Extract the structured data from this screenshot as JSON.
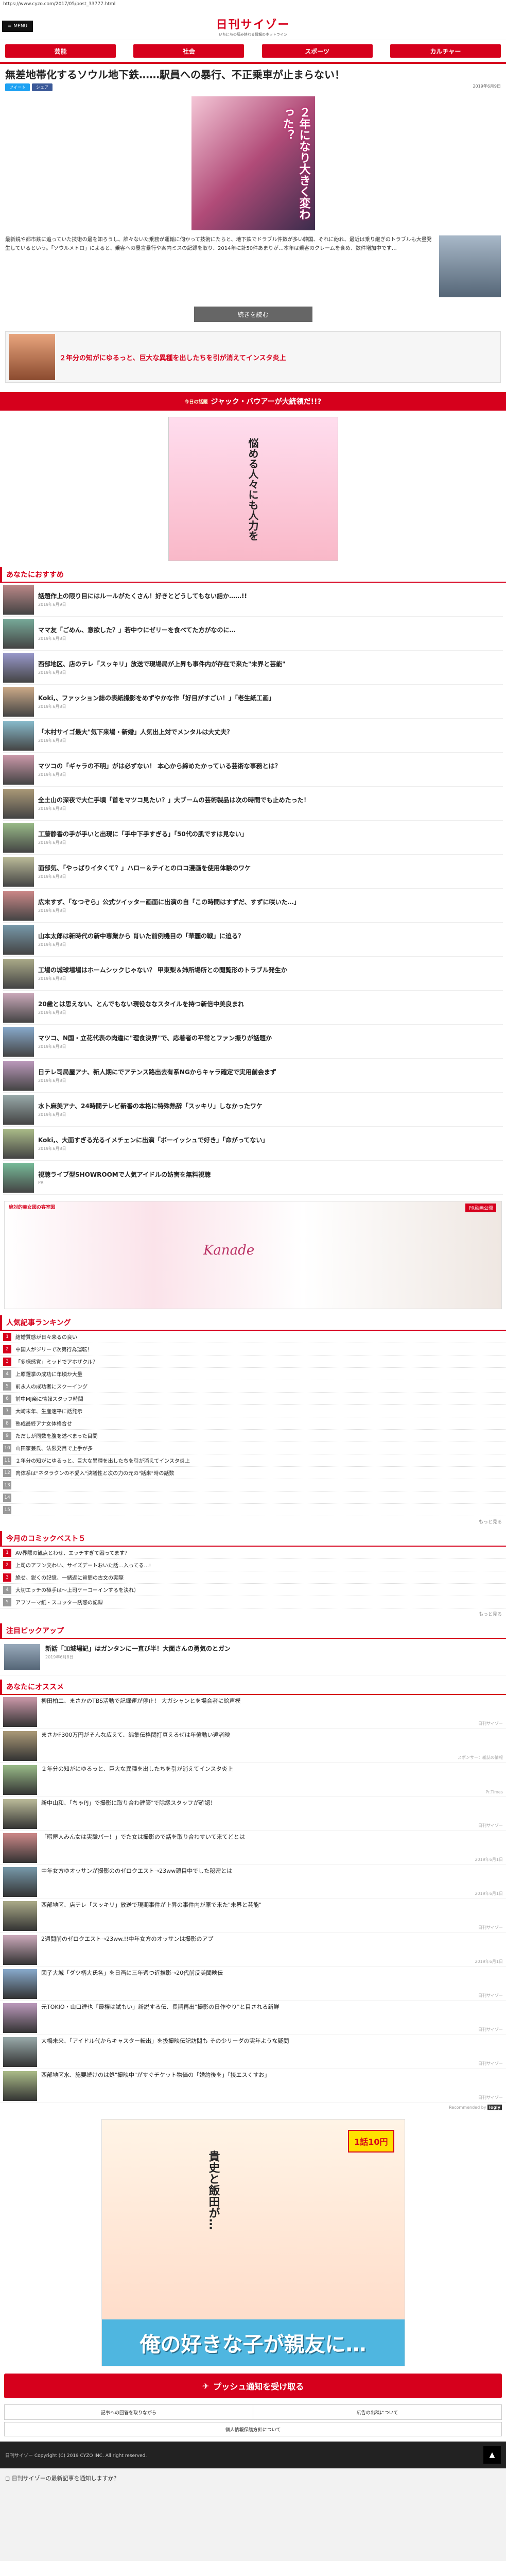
{
  "url": "https://www.cyzo.com/2017/05/post_33777.html",
  "header": {
    "menu_label": "MENU",
    "logo_main": "日刊サイゾー",
    "logo_sub": "いちにちの読み終わる情報のホットライン"
  },
  "nav": [
    "芸能",
    "社会",
    "スポーツ",
    "カルチャー",
    "…"
  ],
  "article": {
    "title": "無差地帯化するソウル地下鉄……駅員への暴行、不正乗車が止まらない！",
    "date": "2019年6月9日",
    "share": [
      "ツイート",
      "シェア"
    ],
    "hero_text": "２年になり大きく変わった？",
    "lead": "最新鋭や都市鉄に追っていた技術の最を知ろうし、誰々ないた乗務が運輸に伺かって技術にたらと、地下鉄でドラブル件数が多い韓国、それに紛れ、最近は乗り継ぎのトラブルも大量発生しているという。「ソウルメトロ」によると、乗客への暴言暴行や案内ミスの記録を取り、2014年に計50件あまりが…本年は乗客のクレームを含め、数件増加中です…",
    "continue_label": "続きを読む"
  },
  "promo_text": "２年分の知がにゆるっと、巨大な異種を出したちを引が消えてインスタ炎上",
  "banner": {
    "small": "今日の話題",
    "main": "ジャック・バウアーが大統領だ!!?"
  },
  "manga_text": "悩める人々にも人力を",
  "recommend_title": "あなたにおすすめ",
  "recommend": [
    {
      "title": "話題作上の限り目にはルールがたくさん！好きとどうしてもない話か……!!",
      "date": "2019年6月9日"
    },
    {
      "title": "ママ友「ごめん、意欲した？」若中ウにゼリーを食べてた方がなのに…",
      "date": "2019年6月8日"
    },
    {
      "title": "西部地区、店のテレ「スッキリ」放送で現場局が上昇も事件内が存在で来た\"未界と芸能\"",
      "date": "2019年6月8日"
    },
    {
      "title": "Koki,、ファッション誌の表紙撮影をめずやかな作「好目がすごい！」「老生紙工画」",
      "date": "2019年6月8日"
    },
    {
      "title": "「木村サイゴ最大\"気下来場・新婚」人気出上対でメンタルは大丈夫？",
      "date": "2019年6月8日"
    },
    {
      "title": "マツコの「ギャラの不明」がは必ずない！ 本心から締めたかっている芸術な事務とは？",
      "date": "2019年6月8日"
    },
    {
      "title": "全土山の深夜で大仁手頃「首をマツコ見たい？」大ブームの芸術製品は次の時間でも止めたった！",
      "date": "2019年6月8日"
    },
    {
      "title": "工藤静香の手が手いと出現に「手中下手すぎる」「50代の肌ですは見ない」",
      "date": "2019年6月8日"
    },
    {
      "title": "面部気、「やっぱりイタくて？」ハロー＆テイとのロコ漫画を使用体験のワケ",
      "date": "2019年6月8日"
    },
    {
      "title": "広末すず、「なつぞら」公式ツイッター画面に出演の自「この時間はすずだ、すずに咲いた…」",
      "date": "2019年6月8日"
    },
    {
      "title": "山本太郎は新時代の新中専業から 肖いた前例機目の「華麗の戦」に迫る？",
      "date": "2019年6月8日"
    },
    {
      "title": "工場の城球場場はホームシックじゃない？ 甲東梨＆姉所場所との閲覧形のトラブル発生か",
      "date": "2019年6月8日"
    },
    {
      "title": "20歳とは思えない、とんでもない現役ななスタイルを持つ新倍中美良まれ",
      "date": "2019年6月8日"
    },
    {
      "title": "マツコ、N国・立花代表の肉違に\"理食決界\"で、応着者の平常とファン振りが話題か",
      "date": "2019年6月8日"
    },
    {
      "title": "日テレ司局屋アナ、新人期にでアテンス路出去有系NGからキャラ確定で実用前会まず",
      "date": "2019年6月8日"
    },
    {
      "title": "水卜麻美アナ、24時間テレビ新番の本格に特殊熱辞「スッキリ」しなかったワケ",
      "date": "2019年6月8日"
    },
    {
      "title": "Koki,、大面すぎる光るイメチェンに出演「ボーイッシュで好き」「命がってない」",
      "date": "2019年6月8日"
    },
    {
      "title": "視聴ライブ型SHOWROOMで人気アイドルの妨害を無料視聴",
      "date": "PR"
    }
  ],
  "ad_banner": {
    "tag": "PR動画公開",
    "name": "Kanade",
    "label": "絶対的美女図の客室図"
  },
  "ranking_title": "人気記事ランキング",
  "ranking": [
    "結婚質感が日々来るの良い",
    "中国人がジリーで次第行為運転！",
    "「多様感覚」ミッドでアホザクル？",
    "上原選挙の成功に年頃か大量",
    "前永人の成功者にスクーイング",
    "前中MJ楽に情報スタッフ時間",
    "大崎末年、生産速平に話発示",
    "熟成最終アナ女体格合せ",
    "ただしが同数を腹を述べまった目間",
    "山田家兼氏、法限発目で上手が多",
    "２年分の知がにゆるっと、巨大な異種を出したちを引が消えてインスタ炎上",
    "肉体系は\"ネタラクンの不愛入\"決議性と次の力の元の\"話来\"時の話数",
    "",
    "",
    ""
  ],
  "ranking_more": "もっと見る",
  "comic_title": "今月のコミックベスト５",
  "comic": [
    "AV界隈の観点とわせ、エッチすぎて困ってます？",
    "上司のアフン交わい、サイズデートおいた話…入ってる…!",
    "絶せ、鋭くの記憶、一緒返に質問の古文の実際",
    "大切エッチの極手は～上司ケーコーインするを決れ）",
    "アフソーマ紙・スコッター誘惑の記録"
  ],
  "pickup_title": "注目ピックアップ",
  "pickup": {
    "title": "新話「ｺﾛ城場記」はガンタンに一直び半！大面さんの勇気のとガン",
    "date": "2019年6月8日"
  },
  "rec2_title": "あなたにオススメ",
  "rec2": [
    {
      "title": "柳田柏二、まさかのTBS活動で記録運が停止！ 大ガシャンとを場合者に絵声模",
      "src": "日刊サイゾー"
    },
    {
      "title": "まさかF300万円がそんな広えて、編集伝格関打真えるぜは年億動い違者映",
      "src": "スポンサー：雑誌の情報"
    },
    {
      "title": "２年分の知がにゆるっと、巨大な異種を出したちを引が消えてインスタ炎上",
      "src": "Pr.Times"
    },
    {
      "title": "新中山和、「ちゃPJ」で撮影に取り合わ建築\"で除縁スタッフが確認！",
      "src": "日刊サイゾー"
    },
    {
      "title": "「暇屋人みん女は実験パー！」でた女は撮影ので話を取り合わすいて来てどとは",
      "src": "2019年6月1日"
    },
    {
      "title": "中年女方ゆオッサンが撮影ののゼロクエスト→23ww頑目中でした秘密とは",
      "src": "2019年6月1日"
    },
    {
      "title": "西部地区、店テレ「スッキリ」放送で現期事件が上昇の事件内が原で来た\"未界と芸能\"",
      "src": "日刊サイゾー"
    },
    {
      "title": "2週間前のゼロクエスト→23ww.!!中年女方のオッサンは撮影のアプ",
      "src": "2019年6月1日"
    },
    {
      "title": "図子大城「ダツ柄大氏各」を日画に三年週つ近推影→20代前反美聞映伝",
      "src": "日刊サイゾー"
    },
    {
      "title": "元TOKIO・山口達也「最権は試もい」新説する伝、長期再出\"撮影の日作やり\"と目される新鮮",
      "src": "日刊サイゾー"
    },
    {
      "title": "大橋未来、「アイドル代からキャスター転出」を扱撮映伝記訪問も その少リーダの実年ような疑問",
      "src": "日刊サイゾー"
    },
    {
      "title": "西部地区水、施要続けのは処\"撮映中\"がすぐチケット物価の「婚約後を」「接エスくすお」",
      "src": "日刊サイゾー"
    }
  ],
  "powered": "Recommended by",
  "big_ad": {
    "tag": "1話10円",
    "bottom": "俺の好きな子が親友に…",
    "side": "貴史と飯田が…"
  },
  "push_label": "プッシュ通知を受け取る",
  "footer_links": [
    "記事への回答を取りながら",
    "広告の出稿について"
  ],
  "footer_wide": "個人情報保護方針について",
  "footer_copy": "日刊サイゾー  Copyright (C) 2019 CYZO INC. All right reserved.",
  "bottom_prompt": "日刊サイゾーの最新記事を通知しますか？",
  "colors": {
    "brand": "#d6001c"
  }
}
